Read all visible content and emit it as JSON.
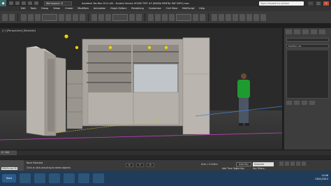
{
  "titlebar": {
    "workspace": "Workspace: D",
    "title": "Autodesk 3ds Max  2014 x64  -  Student Version   HOUSE TEST #3 (NVIDIA MENTAL RAY EXPO).max",
    "search_placeholder": "Type a keyword or phrase"
  },
  "menu": [
    "Edit",
    "Tools",
    "Group",
    "Views",
    "Create",
    "Modifiers",
    "Animation",
    "Graph Editors",
    "Rendering",
    "Customize",
    "Civil View",
    "MAXScript",
    "Help"
  ],
  "viewport": {
    "label": "[+] [Perspective] [Realistic]"
  },
  "command_panel": {
    "modifier_list": "Modifier List"
  },
  "timeline": {
    "slider": "0 / 100"
  },
  "status": {
    "maxscript": "MAXScript Mi",
    "selection": "None Selected",
    "prompt": "Click or click-and-drag to select objects",
    "grid": "Grid = 0.254m",
    "auto_key": "Auto Key",
    "selected": "Selected",
    "add_time_tag": "Add Time Tag",
    "set_key": "Set Key",
    "key_filters": "Key Filters..."
  },
  "taskbar": {
    "start": "Start",
    "time": "14:56",
    "date": "13/01/2014"
  }
}
